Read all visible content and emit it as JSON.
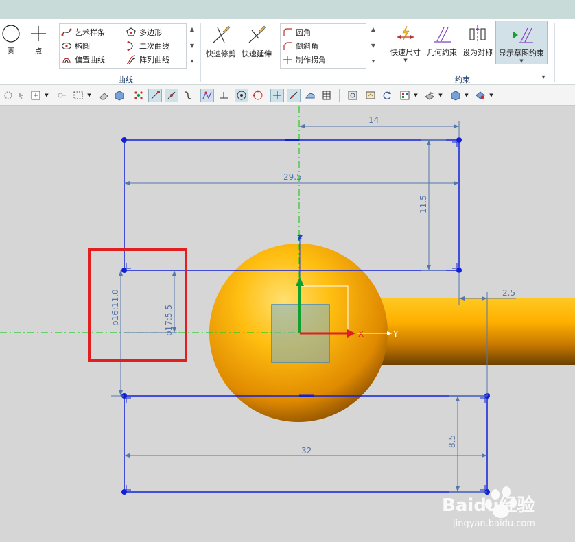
{
  "ribbon": {
    "tools_left": {
      "circle_label": "圆",
      "point_label": "点"
    },
    "curve_list": {
      "col1": [
        "艺术样条",
        "椭圆",
        "偏置曲线"
      ],
      "col2": [
        "多边形",
        "二次曲线",
        "阵列曲线"
      ]
    },
    "curve_group_label": "曲线",
    "edit_buttons": {
      "quick_trim": "快速修剪",
      "quick_extend": "快速延伸"
    },
    "corner_list": [
      "圆角",
      "倒斜角",
      "制作拐角"
    ],
    "constraint_buttons": {
      "quick_dim": "快速尺寸",
      "geo_constraint": "几何约束",
      "set_symmetric": "设为对称",
      "show_constraints": "显示草图约束"
    },
    "constraint_group_label": "约束"
  },
  "sketch": {
    "axis_z": "Z",
    "axis_x": "X",
    "axis_y": "Y",
    "dims": {
      "top_width": "14",
      "top_span": "29.5",
      "top_height": "11.5",
      "right_offset": "2.5",
      "p16": "p16:11.0",
      "p17": "p17:5.5",
      "bottom_height": "8.5",
      "bottom_span": "32"
    }
  },
  "watermark": {
    "logo": "Baidu经验",
    "url": "jingyan.baidu.com"
  },
  "colors": {
    "sketch_blue": "#1020d8",
    "dim_blue": "#5577aa",
    "axis_green": "#22cc22",
    "highlight_red": "#e02020",
    "sphere_orange": "#f0a000"
  }
}
